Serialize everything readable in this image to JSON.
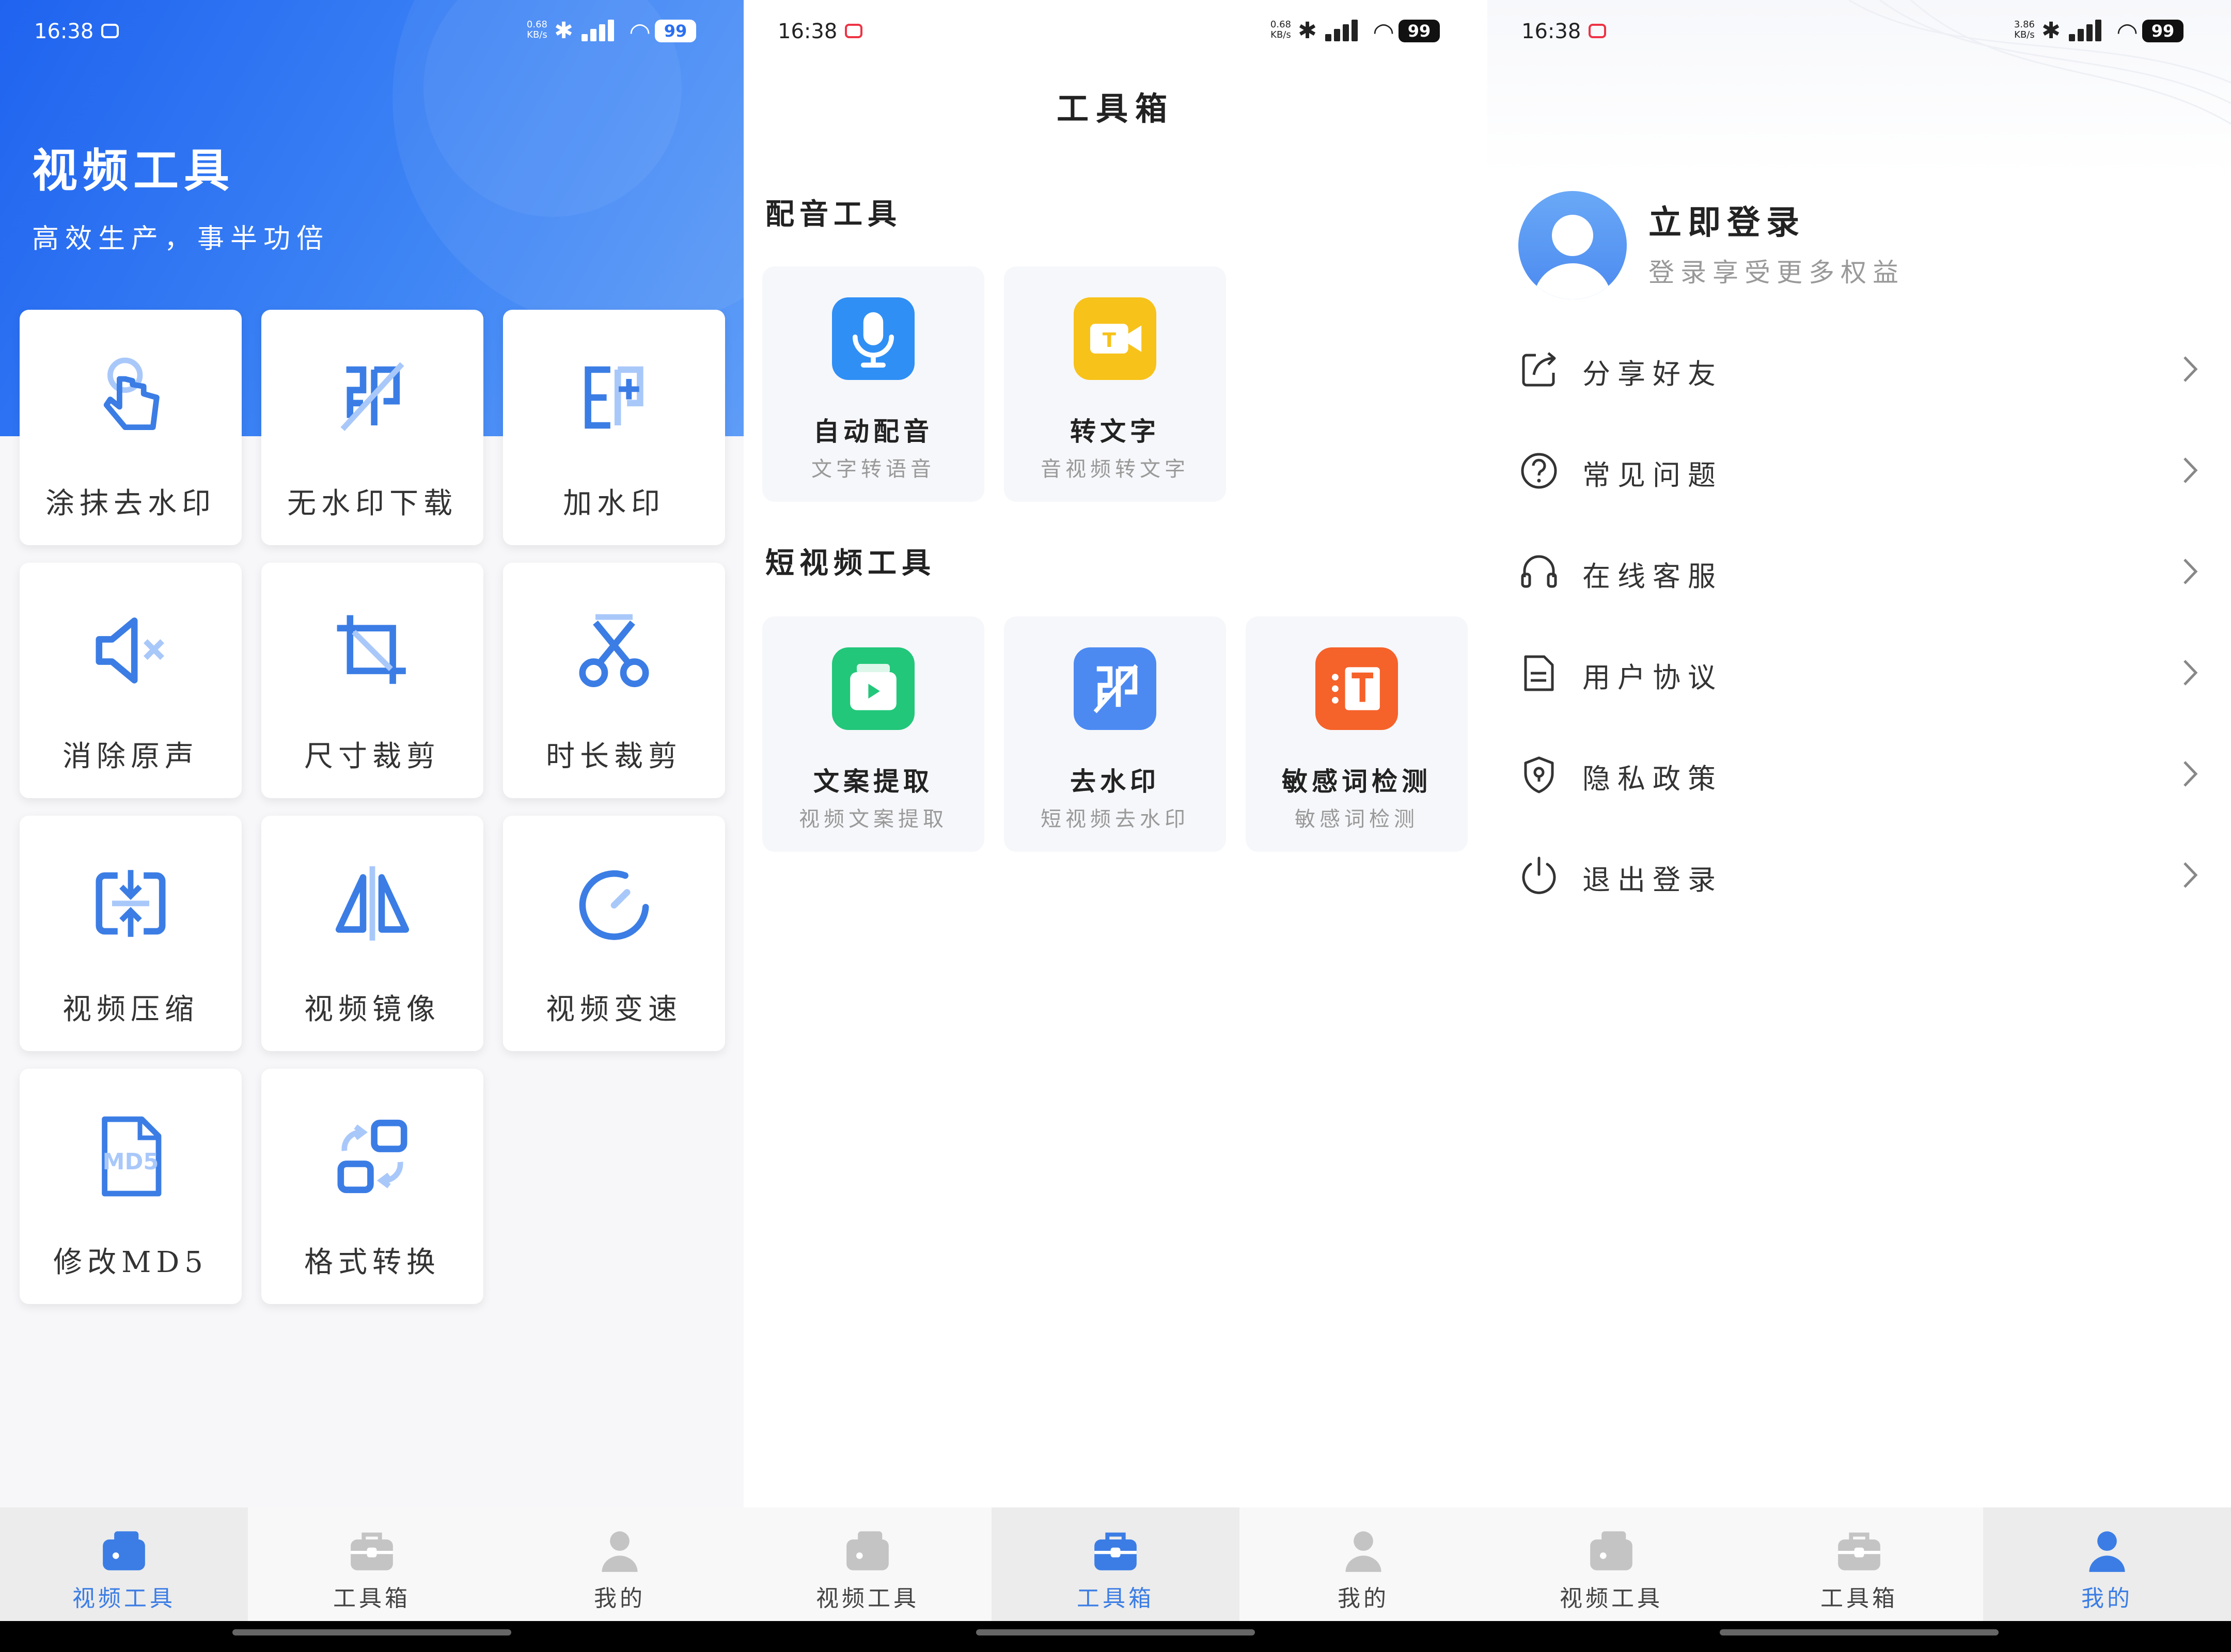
{
  "status_bar": [
    {
      "time": "16:38",
      "netspeed": "0.68\nKB/s",
      "battery": "99"
    },
    {
      "time": "16:38",
      "netspeed": "0.68\nKB/s",
      "battery": "99"
    },
    {
      "time": "16:38",
      "netspeed": "3.86\nKB/s",
      "battery": "99"
    }
  ],
  "video_tools": {
    "title": "视频工具",
    "subtitle": "高效生产，事半功倍",
    "tools": [
      {
        "label": "涂抹去水印",
        "icon": "smear-watermark-icon"
      },
      {
        "label": "无水印下载",
        "icon": "no-watermark-download-icon"
      },
      {
        "label": "加水印",
        "icon": "add-watermark-icon"
      },
      {
        "label": "消除原声",
        "icon": "mute-icon"
      },
      {
        "label": "尺寸裁剪",
        "icon": "crop-icon"
      },
      {
        "label": "时长裁剪",
        "icon": "scissors-icon"
      },
      {
        "label": "视频压缩",
        "icon": "compress-icon"
      },
      {
        "label": "视频镜像",
        "icon": "mirror-icon"
      },
      {
        "label": "视频变速",
        "icon": "speed-icon"
      },
      {
        "label": "修改MD5",
        "icon": "md5-file-icon"
      },
      {
        "label": "格式转换",
        "icon": "format-convert-icon"
      }
    ]
  },
  "toolbox": {
    "title": "工具箱",
    "sections": [
      {
        "title": "配音工具",
        "items": [
          {
            "name": "自动配音",
            "desc": "文字转语音",
            "color": "#2f8ff5",
            "icon": "microphone-icon"
          },
          {
            "name": "转文字",
            "desc": "音视频转文字",
            "color": "#f7c21a",
            "icon": "video-to-text-icon"
          }
        ]
      },
      {
        "title": "短视频工具",
        "items": [
          {
            "name": "文案提取",
            "desc": "视频文案提取",
            "color": "#22c77a",
            "icon": "text-extract-icon"
          },
          {
            "name": "去水印",
            "desc": "短视频去水印",
            "color": "#4c8af2",
            "icon": "remove-watermark-icon"
          },
          {
            "name": "敏感词检测",
            "desc": "敏感词检测",
            "color": "#f5622a",
            "icon": "sensitive-word-icon"
          }
        ]
      }
    ]
  },
  "profile": {
    "login_title": "立即登录",
    "login_subtitle": "登录享受更多权益",
    "menu": [
      {
        "label": "分享好友",
        "icon": "share-icon"
      },
      {
        "label": "常见问题",
        "icon": "question-icon"
      },
      {
        "label": "在线客服",
        "icon": "headset-icon"
      },
      {
        "label": "用户协议",
        "icon": "document-icon"
      },
      {
        "label": "隐私政策",
        "icon": "shield-icon"
      },
      {
        "label": "退出登录",
        "icon": "power-icon"
      }
    ]
  },
  "nav": {
    "items": [
      "视频工具",
      "工具箱",
      "我的"
    ]
  },
  "colors": {
    "accent": "#3b7de5",
    "hero_blue": "#2a6ff0"
  }
}
